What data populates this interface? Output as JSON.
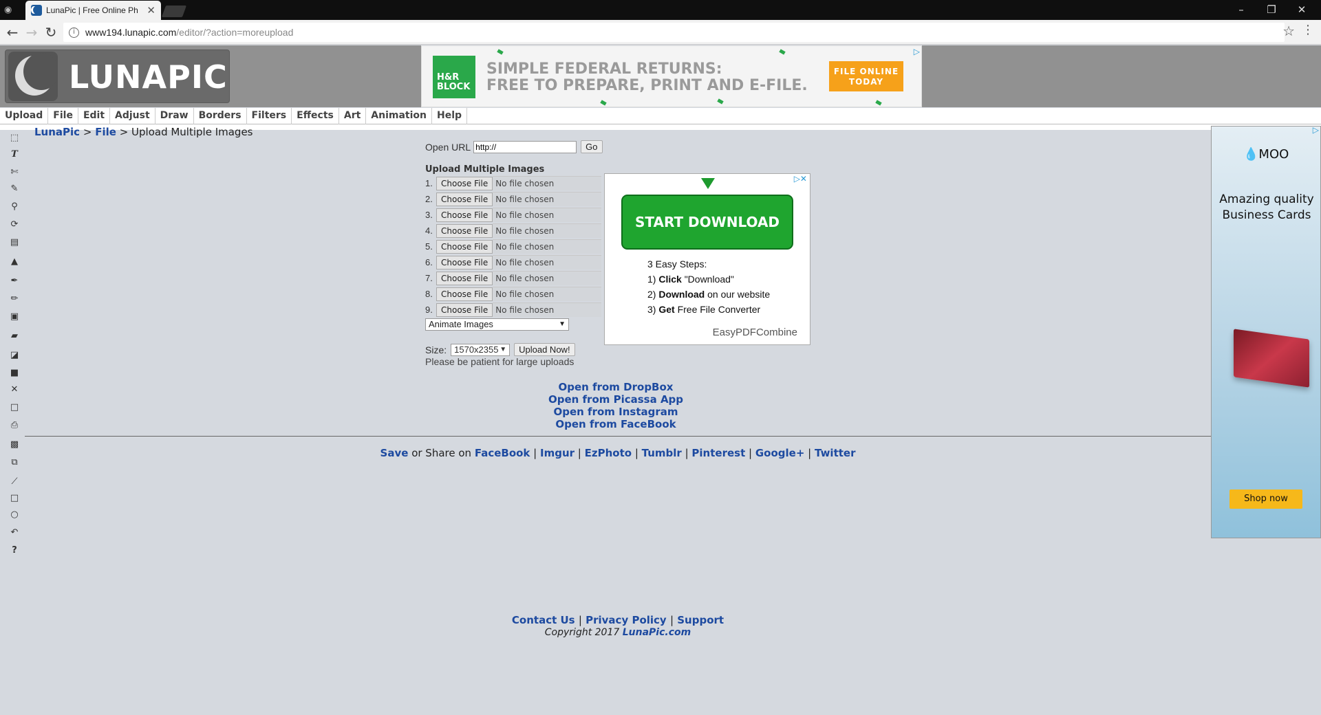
{
  "browser": {
    "tab_title": "LunaPic | Free Online Ph",
    "url_host": "www194.lunapic.com",
    "url_path": "/editor/?action=moreupload"
  },
  "header": {
    "logo_text": "LUNAPIC"
  },
  "top_ad": {
    "brand": "H&R BLOCK",
    "line1": "SIMPLE FEDERAL RETURNS:",
    "line2": "FREE TO PREPARE, PRINT AND E-FILE.",
    "cta": "FILE ONLINE TODAY"
  },
  "menu": [
    "Upload",
    "File",
    "Edit",
    "Adjust",
    "Draw",
    "Borders",
    "Filters",
    "Effects",
    "Art",
    "Animation",
    "Help"
  ],
  "breadcrumb": {
    "home": "LunaPic",
    "section": "File",
    "current": "Upload Multiple Images"
  },
  "open_url": {
    "label": "Open URL",
    "value": "http://",
    "go": "Go"
  },
  "upload": {
    "title": "Upload Multiple Images",
    "choose_label": "Choose File",
    "no_file": "No file chosen",
    "rows": [
      "1.",
      "2.",
      "3.",
      "4.",
      "5.",
      "6.",
      "7.",
      "8.",
      "9."
    ],
    "animate_option": "Animate Images",
    "size_label": "Size:",
    "size_value": "1570x2355",
    "upload_button": "Upload Now!",
    "patient_note": "Please be patient for large uploads"
  },
  "open_from": [
    "Open from DropBox",
    "Open from Picassa App",
    "Open from Instagram",
    "Open from FaceBook"
  ],
  "mid_ad": {
    "button": "START DOWNLOAD",
    "steps_title": "3 Easy Steps:",
    "step1_bold": "Click",
    "step1_rest": "\"Download\"",
    "step2_bold": "Download",
    "step2_rest": "on our website",
    "step3_bold": "Get",
    "step3_rest": "Free File Converter",
    "brand": "EasyPDFCombine"
  },
  "share": {
    "save": "Save",
    "middle": "or Share on",
    "targets": [
      "FaceBook",
      "Imgur",
      "EzPhoto",
      "Tumblr",
      "Pinterest",
      "Google+",
      "Twitter"
    ]
  },
  "footer": {
    "contact": "Contact Us",
    "privacy": "Privacy Policy",
    "support": "Support",
    "copyright_prefix": "Copyright 2017",
    "copyright_site": "LunaPic.com"
  },
  "right_ad": {
    "brand": "MOO",
    "tagline": "Amazing quality Business Cards",
    "cta": "Shop now"
  },
  "colors": {
    "link": "#1d4aa0",
    "page_bg": "#d5d9df",
    "header_bg": "#919191",
    "download_green": "#1fa52f"
  }
}
